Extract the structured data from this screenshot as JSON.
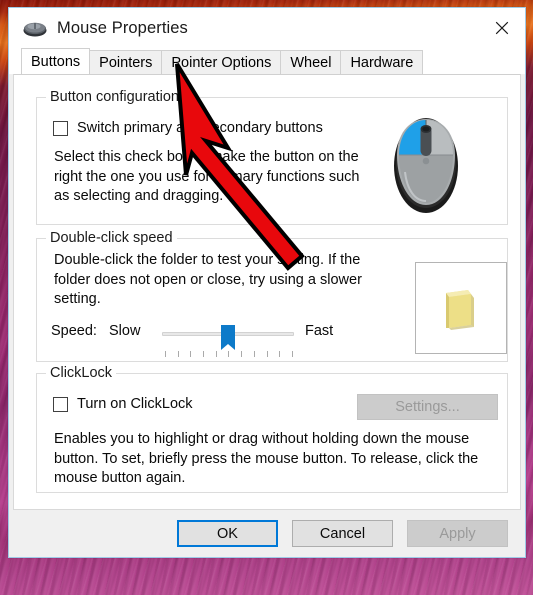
{
  "window": {
    "title": "Mouse Properties",
    "icon": "mouse-icon",
    "close_label": "✕"
  },
  "tabs": [
    {
      "label": "Buttons",
      "selected": true
    },
    {
      "label": "Pointers",
      "selected": false
    },
    {
      "label": "Pointer Options",
      "selected": false
    },
    {
      "label": "Wheel",
      "selected": false
    },
    {
      "label": "Hardware",
      "selected": false
    }
  ],
  "button_configuration": {
    "group_title": "Button configuration",
    "switch_buttons_label": "Switch primary and secondary buttons",
    "switch_buttons_checked": false,
    "description": "Select this check box to make the button on the right the one you use for primary functions such as selecting and dragging.",
    "illustration": "mouse-illustration"
  },
  "double_click_speed": {
    "group_title": "Double-click speed",
    "description": "Double-click the folder to test your setting. If the folder does not open or close, try using a slower setting.",
    "speed_label": "Speed:",
    "slow_label": "Slow",
    "fast_label": "Fast",
    "slider_value": 50,
    "slider_min": 0,
    "slider_max": 100,
    "tick_count": 11,
    "test_icon": "folder-icon"
  },
  "clicklock": {
    "group_title": "ClickLock",
    "turn_on_label": "Turn on ClickLock",
    "turn_on_checked": false,
    "settings_button_label": "Settings...",
    "settings_button_enabled": false,
    "description": "Enables you to highlight or drag without holding down the mouse button. To set, briefly press the mouse button. To release, click the mouse button again."
  },
  "footer": {
    "ok_label": "OK",
    "cancel_label": "Cancel",
    "apply_label": "Apply",
    "apply_enabled": false
  },
  "annotation": {
    "type": "arrow",
    "color": "#e8080c",
    "outline_color": "#000000",
    "points_to": "Pointer Options"
  },
  "colors": {
    "accent": "#0078d7",
    "slider_thumb": "#0d7ac9",
    "annotation_red": "#e8080c",
    "dialog_bg": "#f0f0f0",
    "tab_bg": "#ffffff"
  }
}
